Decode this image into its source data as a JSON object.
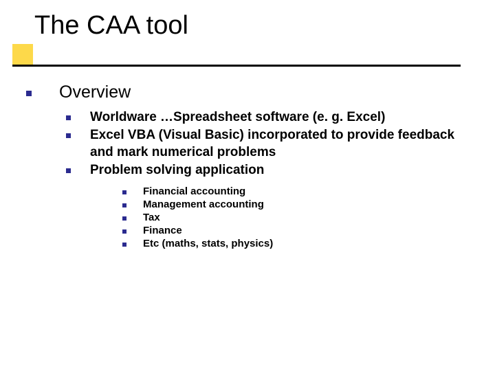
{
  "title": "The CAA tool",
  "level1": "Overview",
  "level2": [
    "Worldware …Spreadsheet software (e. g. Excel)",
    "Excel VBA (Visual Basic) incorporated to provide feedback and mark numerical problems",
    "Problem solving application"
  ],
  "level3": [
    "Financial accounting",
    "Management accounting",
    "Tax",
    "Finance",
    "Etc (maths, stats, physics)"
  ]
}
